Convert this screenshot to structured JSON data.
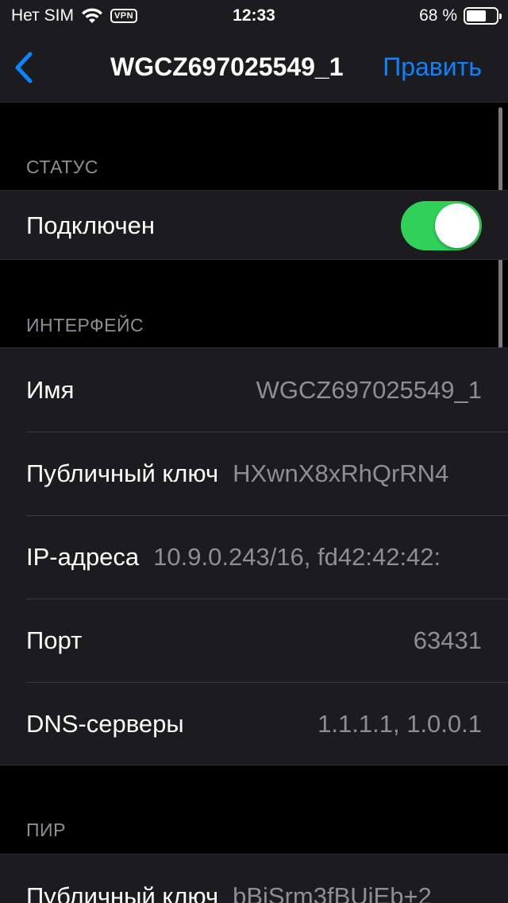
{
  "status_bar": {
    "carrier": "Нет SIM",
    "vpn": "VPN",
    "time": "12:33",
    "battery_percent_text": "68 %",
    "battery_level": 0.68
  },
  "nav": {
    "title": "WGCZ697025549_1",
    "edit_label": "Править"
  },
  "status_section": {
    "header": "СТАТУС",
    "connected_label": "Подключен",
    "connected": true
  },
  "interface_section": {
    "header": "ИНТЕРФЕЙС",
    "rows": [
      {
        "label": "Имя",
        "value": "WGCZ697025549_1"
      },
      {
        "label": "Публичный ключ",
        "value": "HXwnX8xRhQrRN4"
      },
      {
        "label": "IP-адреса",
        "value": "10.9.0.243/16, fd42:42:42:"
      },
      {
        "label": "Порт",
        "value": "63431"
      },
      {
        "label": "DNS-серверы",
        "value": "1.1.1.1, 1.0.0.1"
      }
    ]
  },
  "peer_section": {
    "header": "ПИР",
    "rows": [
      {
        "label": "Публичный ключ",
        "value": "bBiSrm3fBUiEb+2"
      }
    ]
  },
  "colors": {
    "accent": "#0a84ff",
    "toggle_on": "#30d158",
    "cell_bg": "#1c1c1e",
    "secondary_text": "#8e8e93"
  }
}
